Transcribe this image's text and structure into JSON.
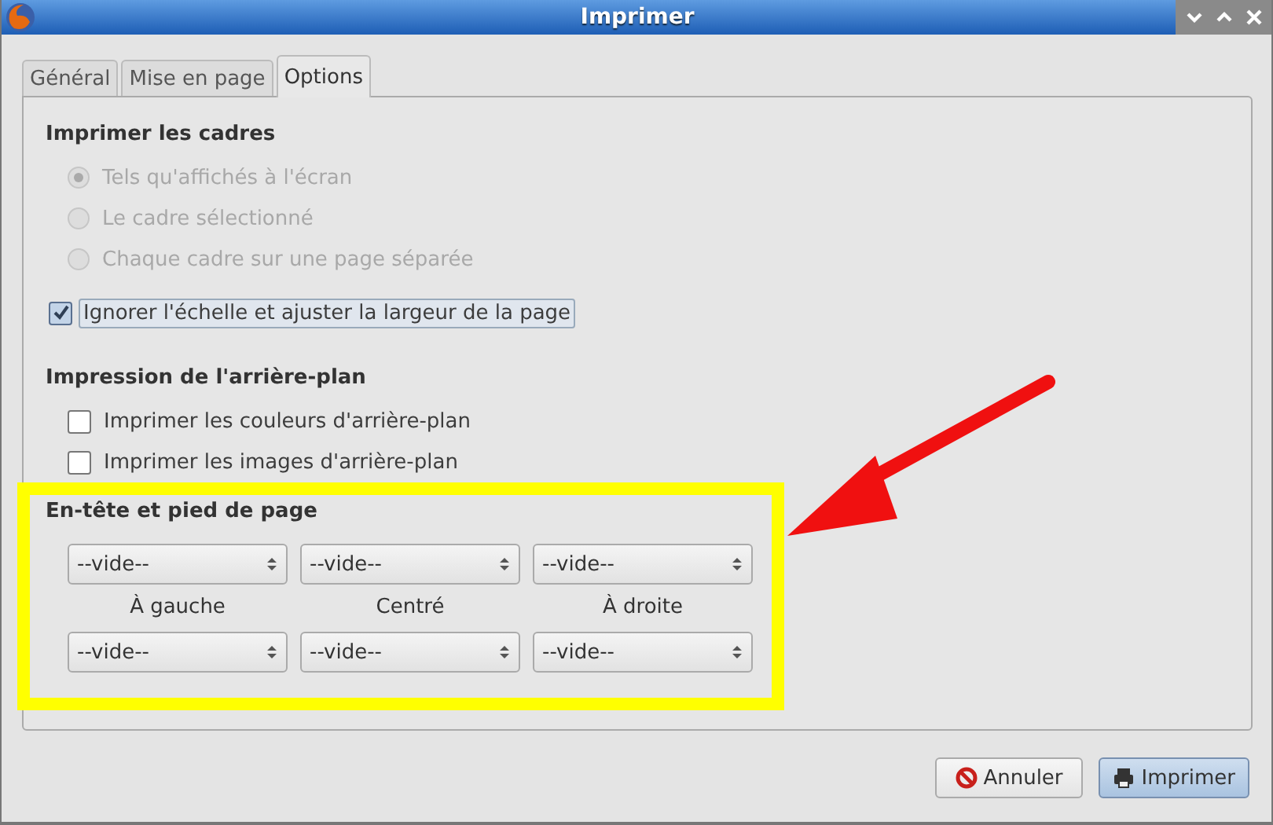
{
  "window": {
    "title": "Imprimer",
    "controls": [
      {
        "kind": "minimize"
      },
      {
        "kind": "maximize"
      },
      {
        "kind": "close"
      }
    ]
  },
  "tabs": [
    {
      "label": "Général",
      "selected": false
    },
    {
      "label": "Mise en page",
      "selected": false
    },
    {
      "label": "Options",
      "selected": true
    }
  ],
  "frames": {
    "title": "Imprimer les cadres",
    "options": [
      {
        "label": "Tels qu'affichés à l'écran",
        "selected": true,
        "disabled": true
      },
      {
        "label": "Le cadre sélectionné",
        "selected": false,
        "disabled": true
      },
      {
        "label": "Chaque cadre sur une page séparée",
        "selected": false,
        "disabled": true
      }
    ],
    "shrink": {
      "label": "Ignorer l'échelle et ajuster la largeur de la page",
      "checked": true
    }
  },
  "background": {
    "title": "Impression de l'arrière-plan",
    "options": [
      {
        "label": "Imprimer les couleurs d'arrière-plan",
        "checked": false
      },
      {
        "label": "Imprimer les images d'arrière-plan",
        "checked": false
      }
    ]
  },
  "header_footer": {
    "title": "En-tête et pied de page",
    "headers": [
      "--vide--",
      "--vide--",
      "--vide--"
    ],
    "labels": [
      "À gauche",
      "Centré",
      "À droite"
    ],
    "footers": [
      "--vide--",
      "--vide--",
      "--vide--"
    ]
  },
  "buttons": [
    {
      "label": "Annuler",
      "kind": "cancel",
      "default": false
    },
    {
      "label": "Imprimer",
      "kind": "print",
      "default": true
    }
  ]
}
